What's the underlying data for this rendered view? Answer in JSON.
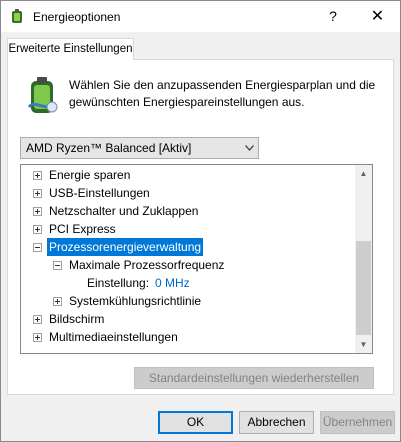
{
  "window": {
    "title": "Energieoptionen",
    "help_label": "?",
    "close_label": "✕"
  },
  "tab": {
    "label": "Erweiterte Einstellungen"
  },
  "description": "Wählen Sie den anzupassenden Energiesparplan und die gewünschten Energiespareinstellungen aus.",
  "plan_select": {
    "value": "AMD Ryzen™ Balanced [Aktiv]"
  },
  "tree": {
    "items": [
      {
        "label": "Energie sparen",
        "expanded": false
      },
      {
        "label": "USB-Einstellungen",
        "expanded": false
      },
      {
        "label": "Netzschalter und Zuklappen",
        "expanded": false
      },
      {
        "label": "PCI Express",
        "expanded": false
      },
      {
        "label": "Prozessorenergieverwaltung",
        "expanded": true,
        "selected": true
      },
      {
        "label": "Maximale Prozessorfrequenz",
        "expanded": true
      },
      {
        "label": "Einstellung:",
        "value": "0 MHz"
      },
      {
        "label": "Systemkühlungsrichtlinie",
        "expanded": false
      },
      {
        "label": "Bildschirm",
        "expanded": false
      },
      {
        "label": "Multimediaeinstellungen",
        "expanded": false
      }
    ]
  },
  "buttons": {
    "restore": "Standardeinstellungen wiederherstellen",
    "ok": "OK",
    "cancel": "Abbrechen",
    "apply": "Übernehmen"
  },
  "colors": {
    "selection": "#0078d7",
    "link_value": "#0066cc",
    "disabled_text": "#838383"
  }
}
